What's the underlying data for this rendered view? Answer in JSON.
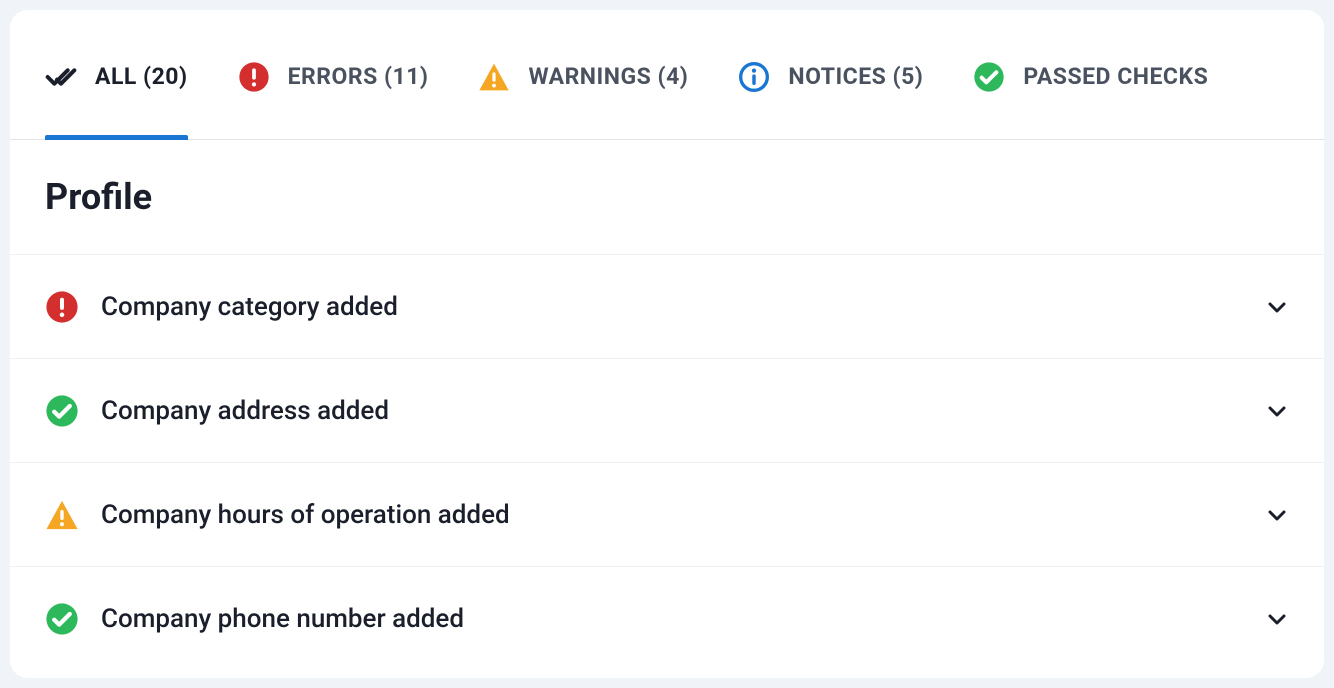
{
  "tabs": {
    "all": {
      "label": "ALL (20)"
    },
    "errors": {
      "label": "ERRORS (11)"
    },
    "warnings": {
      "label": "WARNINGS (4)"
    },
    "notices": {
      "label": "NOTICES (5)"
    },
    "passed": {
      "label": "PASSED CHECKS"
    }
  },
  "section": {
    "title": "Profile"
  },
  "checks": {
    "c0": {
      "label": "Company category added"
    },
    "c1": {
      "label": "Company address added"
    },
    "c2": {
      "label": "Company hours of operation added"
    },
    "c3": {
      "label": "Company phone number added"
    }
  },
  "colors": {
    "error": "#d32f2f",
    "warning": "#f5a623",
    "passed": "#2eb85c",
    "notice": "#1976d2"
  }
}
